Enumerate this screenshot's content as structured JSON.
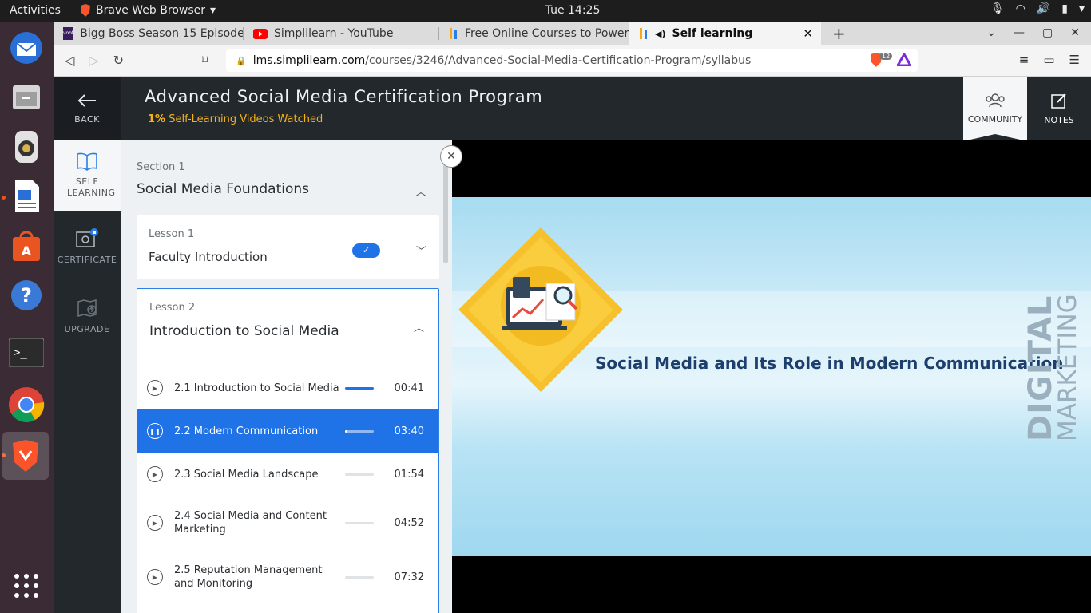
{
  "system": {
    "activities": "Activities",
    "app_name": "Brave Web Browser",
    "clock": "Tue 14:25"
  },
  "browser": {
    "tabs": [
      {
        "label": "Bigg Boss Season 15 Episode",
        "icon": "voot-icon"
      },
      {
        "label": "Simplilearn - YouTube",
        "icon": "youtube-icon"
      },
      {
        "label": "Free Online Courses to Power",
        "icon": "simplilearn-icon"
      },
      {
        "label": "Self learning",
        "icon": "speaker-icon"
      }
    ],
    "url_domain": "lms.simplilearn.com",
    "url_path": "/courses/3246/Advanced-Social-Media-Certification-Program/syllabus",
    "shield_count": "12"
  },
  "app": {
    "back_label": "BACK",
    "course_title": "Advanced Social Media Certification Program",
    "progress_value": "1%",
    "progress_label": "Self-Learning Videos Watched",
    "community_label": "COMMUNITY",
    "notes_label": "NOTES"
  },
  "leftnav": {
    "self_learning": "SELF LEARNING",
    "certificate": "CERTIFICATE",
    "upgrade": "UPGRADE"
  },
  "syllabus": {
    "section_label": "Section 1",
    "section_title": "Social Media Foundations",
    "lesson1": {
      "label": "Lesson 1",
      "title": "Faculty Introduction"
    },
    "lesson2": {
      "label": "Lesson 2",
      "title": "Introduction to Social Media",
      "videos": [
        {
          "title": "2.1 Introduction to Social Media",
          "duration": "00:41",
          "progress": 1.0
        },
        {
          "title": "2.2 Modern Communication",
          "duration": "03:40",
          "progress": 0.05
        },
        {
          "title": "2.3 Social Media Landscape",
          "duration": "01:54",
          "progress": 0
        },
        {
          "title": "2.4 Social Media and Content Marketing",
          "duration": "04:52",
          "progress": 0
        },
        {
          "title": "2.5 Reputation Management and Monitoring",
          "duration": "07:32",
          "progress": 0
        }
      ]
    }
  },
  "player": {
    "slide_title": "Social Media and Its Role in Modern Communication",
    "vertical_word1": "DIGITAL",
    "vertical_word2": "MARKETING"
  },
  "colors": {
    "accent": "#1f73e6",
    "progress": "#f5b31a",
    "header": "#23282d"
  }
}
